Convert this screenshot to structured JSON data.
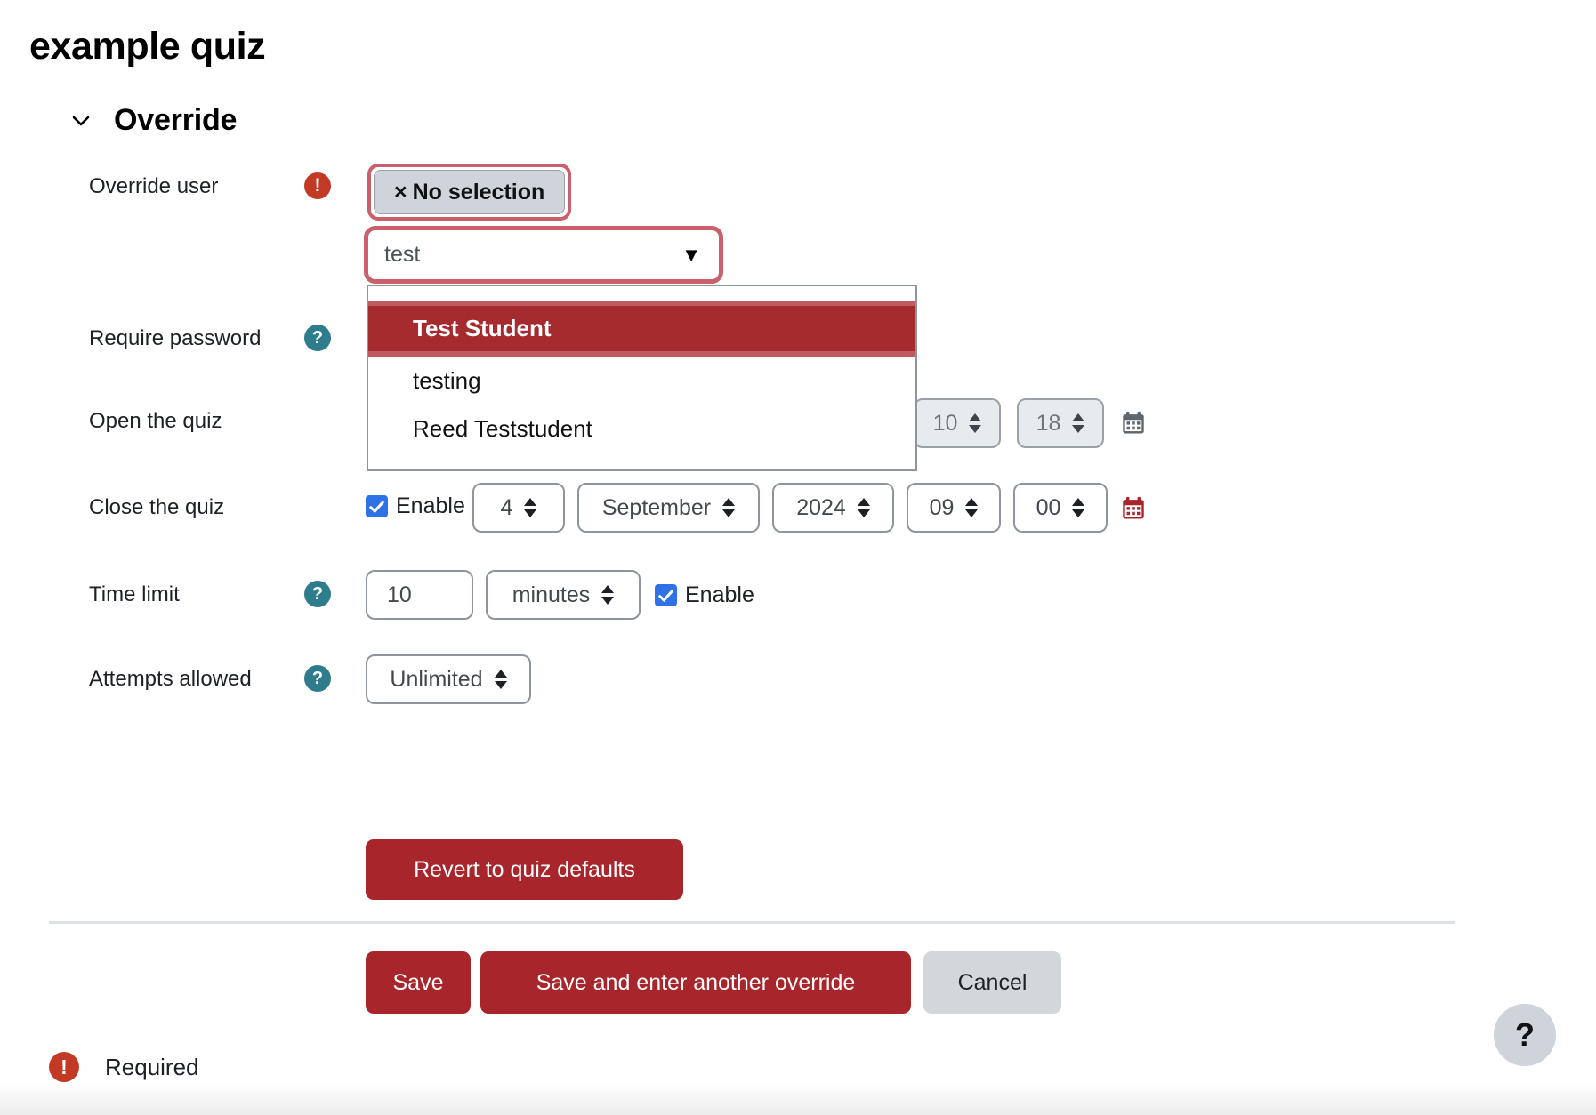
{
  "page": {
    "title": "example quiz"
  },
  "section": {
    "title": "Override",
    "chevron_icon": "chevron-down-icon"
  },
  "fields": {
    "override_user": {
      "label": "Override user",
      "required_icon": "!",
      "selection_pill": {
        "remove_icon": "×",
        "text": "No selection"
      },
      "input_value": "test",
      "dropdown_arrow": "▼",
      "suggestions": [
        "Test Student",
        "testing",
        "Reed Teststudent"
      ],
      "selected_suggestion_index": 0
    },
    "require_password": {
      "label": "Require password",
      "help_icon": "?"
    },
    "open_the_quiz": {
      "label": "Open the quiz",
      "hour": "10",
      "minute": "18",
      "calendar_icon": "calendar-icon"
    },
    "close_the_quiz": {
      "label": "Close the quiz",
      "enable_label": "Enable",
      "day": "4",
      "month": "September",
      "year": "2024",
      "hour": "09",
      "minute": "00",
      "calendar_icon": "calendar-icon"
    },
    "time_limit": {
      "label": "Time limit",
      "help_icon": "?",
      "value": "10",
      "unit": "minutes",
      "enable_label": "Enable"
    },
    "attempts_allowed": {
      "label": "Attempts allowed",
      "help_icon": "?",
      "value": "Unlimited"
    }
  },
  "buttons": {
    "revert": "Revert to quiz defaults",
    "save": "Save",
    "save_another": "Save and enter another override",
    "cancel": "Cancel"
  },
  "legend": {
    "required_icon": "!",
    "required_text": "Required"
  },
  "floating": {
    "help_label": "?"
  },
  "colors": {
    "brand_red": "#a8262b",
    "highlight_red": "#a52b2e",
    "focus_ring": "#c9606b",
    "help_teal": "#2f7c8c",
    "required_red": "#c23a26",
    "checkbox_blue": "#2f72e8",
    "disabled_grey": "#e7ebee"
  }
}
